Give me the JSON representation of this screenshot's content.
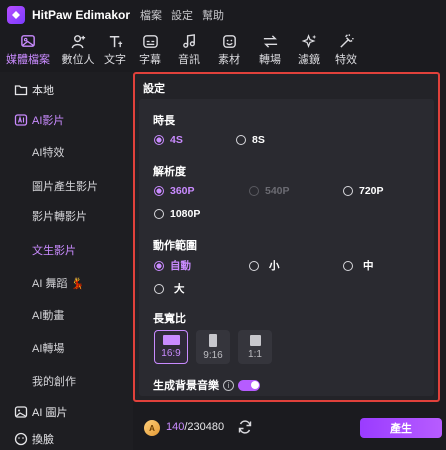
{
  "app": {
    "title": "HitPaw Edimakor"
  },
  "menu": [
    "檔案",
    "設定",
    "幫助"
  ],
  "toolbar": [
    {
      "label": "媒體檔案",
      "icon": "media-icon",
      "active": true
    },
    {
      "label": "數位人",
      "icon": "avatar-add-icon"
    },
    {
      "label": "文字",
      "icon": "text-icon"
    },
    {
      "label": "字幕",
      "icon": "subtitle-icon"
    },
    {
      "label": "音訊",
      "icon": "music-icon"
    },
    {
      "label": "素材",
      "icon": "sticker-icon"
    },
    {
      "label": "轉場",
      "icon": "transition-icon"
    },
    {
      "label": "濾鏡",
      "icon": "filter-icon"
    },
    {
      "label": "特效",
      "icon": "effect-icon"
    }
  ],
  "sidebar": {
    "local": "本地",
    "ai_video": "AI影片",
    "sub_items": [
      "AI特效",
      "圖片產生影片",
      "影片轉影片",
      "文生影片",
      "AI 舞蹈",
      "AI動畫",
      "AI轉場",
      "我的創作"
    ],
    "ai_image": "AI 圖片",
    "swap": "換臉"
  },
  "settings": {
    "title": "設定",
    "duration": {
      "label": "時長",
      "options": [
        "4S",
        "8S"
      ],
      "selected": "4S"
    },
    "resolution": {
      "label": "解析度",
      "options": [
        "360P",
        "540P",
        "720P",
        "1080P"
      ],
      "selected": "360P",
      "disabled": [
        "540P"
      ]
    },
    "motion": {
      "label": "動作範圍",
      "options": [
        "自動",
        "小",
        "中",
        "大"
      ],
      "selected": "自動"
    },
    "aspect": {
      "label": "長寬比",
      "options": [
        "16:9",
        "9:16",
        "1:1"
      ],
      "selected": "16:9"
    },
    "bgm": {
      "label": "生成背景音樂",
      "enabled": true
    }
  },
  "footer": {
    "credits_used": "140",
    "credits_total": "/230480",
    "coin_glyph": "A",
    "generate": "產生"
  },
  "colors": {
    "accent": "#c98bff",
    "highlight_border": "#e0413b",
    "button": "#b65cff"
  }
}
